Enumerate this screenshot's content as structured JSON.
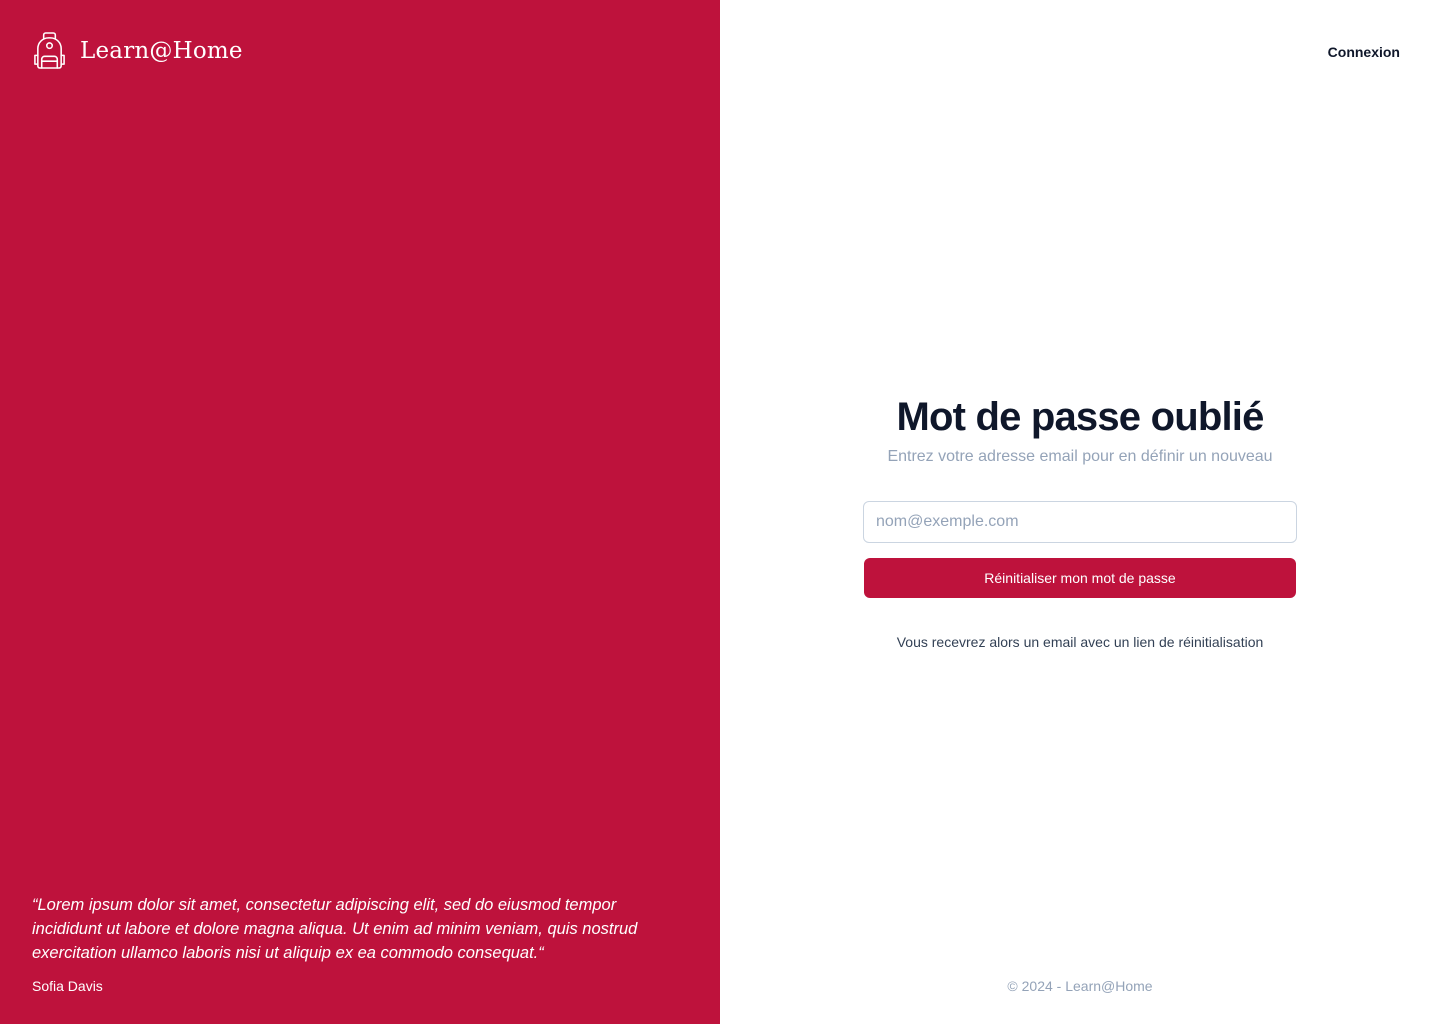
{
  "brand": {
    "name": "Learn@Home",
    "icon": "backpack-icon",
    "color": "#BE123C"
  },
  "testimonial": {
    "quote": "“Lorem ipsum dolor sit amet, consectetur adipiscing elit, sed do eiusmod tempor incididunt ut labore et dolore magna aliqua. Ut enim ad minim veniam, quis nostrud exercitation ullamco laboris nisi ut aliquip ex ea commodo consequat.“",
    "author": "Sofia Davis"
  },
  "header": {
    "login_label": "Connexion"
  },
  "form": {
    "title": "Mot de passe oublié",
    "subtitle": "Entrez votre adresse email pour en définir un nouveau",
    "email_placeholder": "nom@exemple.com",
    "email_value": "",
    "submit_label": "Réinitialiser mon mot de passe",
    "info_text": "Vous recevrez alors un email avec un lien de réinitialisation"
  },
  "footer": {
    "text": "© 2024 - Learn@Home"
  }
}
